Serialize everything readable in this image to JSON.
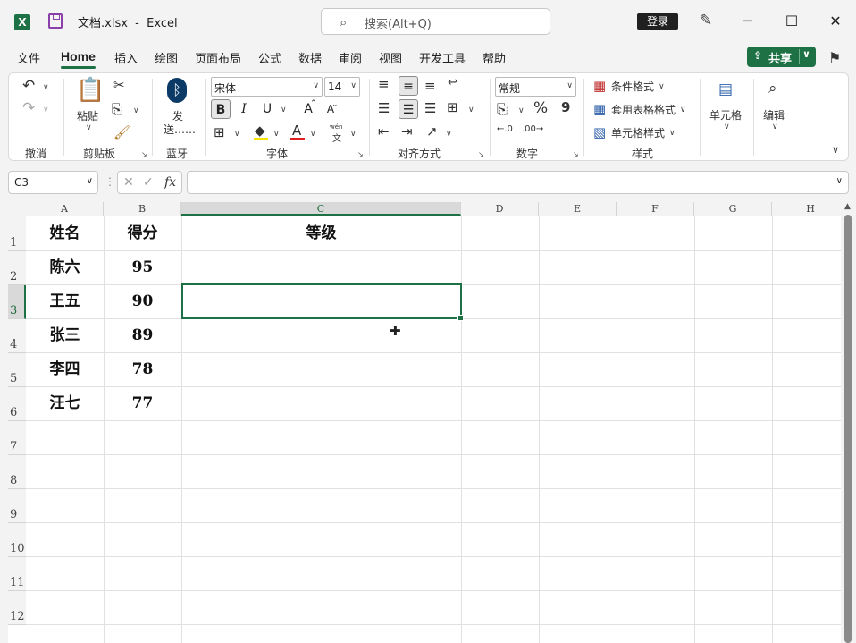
{
  "titlebar": {
    "filename": "文档.xlsx",
    "separator": "-",
    "app": "Excel",
    "search_placeholder": "搜索(Alt+Q)",
    "login": "登录",
    "minimize": "─",
    "maximize": "☐",
    "close": "✕"
  },
  "tabs": [
    "文件",
    "Home",
    "插入",
    "绘图",
    "页面布局",
    "公式",
    "数据",
    "审阅",
    "视图",
    "开发工具",
    "帮助"
  ],
  "share": {
    "label": "共享"
  },
  "ribbon": {
    "undo_group": "撤消",
    "clipboard": {
      "label": "剪贴板",
      "paste": "粘贴"
    },
    "bluetooth": {
      "label": "蓝牙",
      "send_line1": "发",
      "send_line2": "送……"
    },
    "font": {
      "label": "字体",
      "name": "宋体",
      "size": "14",
      "bold": "B",
      "italic": "I",
      "underline": "U",
      "grow": "A",
      "shrink": "A",
      "font_color": "A",
      "phonetic_top": "wén",
      "phonetic_bottom": "文"
    },
    "alignment": {
      "label": "对齐方式"
    },
    "number": {
      "label": "数字",
      "format": "常规",
      "percent": "%",
      "comma": "9"
    },
    "styles": {
      "label": "样式",
      "conditional": "条件格式",
      "table": "套用表格格式",
      "cell_styles": "单元格样式"
    },
    "cells": {
      "label": "单元格"
    },
    "editing": {
      "label": "编辑"
    }
  },
  "formula_bar": {
    "name_box": "C3",
    "fx": "fx",
    "formula": ""
  },
  "sheet": {
    "columns": [
      "A",
      "B",
      "C",
      "D",
      "E",
      "F",
      "G",
      "H"
    ],
    "rows": [
      "1",
      "2",
      "3",
      "4",
      "5",
      "6",
      "7",
      "8",
      "9",
      "10",
      "11",
      "12"
    ],
    "active_cell": "C3",
    "data": [
      [
        "姓名",
        "得分",
        "等级"
      ],
      [
        "陈六",
        "95",
        ""
      ],
      [
        "王五",
        "90",
        ""
      ],
      [
        "张三",
        "89",
        ""
      ],
      [
        "李四",
        "78",
        ""
      ],
      [
        "汪七",
        "77",
        ""
      ]
    ]
  },
  "colors": {
    "accent": "#1e7145",
    "grid": "#e1e1e1",
    "header_bg": "#f3f3f3"
  }
}
